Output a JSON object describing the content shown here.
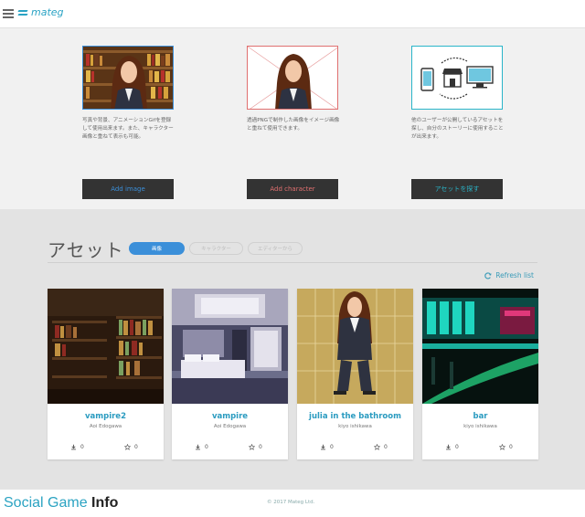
{
  "header": {
    "logo_text": "mateg",
    "menu_icon": "hamburger-icon"
  },
  "features": [
    {
      "description": "写真や背景、アニメーションGifを登録して使用出来ます。また、キャラクター画像と重ねて表示も可能。",
      "button_label": "Add image",
      "accent": "#3b8fd9"
    },
    {
      "description": "透過PNGで制作した画像をイメージ画像と重ねて使用できます。",
      "button_label": "Add character",
      "accent": "#e07070"
    },
    {
      "description": "他のユーザーが公開しているアセットを探し、自分のストーリーに使用することが出来ます。",
      "button_label": "アセットを探す",
      "accent": "#2ab5c9"
    }
  ],
  "assets": {
    "title": "アセット",
    "tabs": [
      "画像",
      "キャラクター",
      "エディターから"
    ],
    "active_tab": 0,
    "refresh_label": "Refresh list",
    "cards": [
      {
        "title": "vampire2",
        "author": "Aoi Edogawa",
        "downloads": "0",
        "favorites": "0"
      },
      {
        "title": "vampire",
        "author": "Aoi Edogawa",
        "downloads": "0",
        "favorites": "0"
      },
      {
        "title": "julia in the bathroom",
        "author": "kiyo ishikawa",
        "downloads": "0",
        "favorites": "0"
      },
      {
        "title": "bar",
        "author": "kiyo ishikawa",
        "downloads": "0",
        "favorites": "0"
      }
    ]
  },
  "footer": {
    "watermark_a": "Social Game",
    "watermark_b": "Info",
    "copyright": "© 2017 Mateg Ltd."
  },
  "colors": {
    "accent_blue": "#3b8fd9",
    "accent_red": "#e07070",
    "accent_teal": "#2ab5c9",
    "link_teal": "#2a9bc0"
  }
}
